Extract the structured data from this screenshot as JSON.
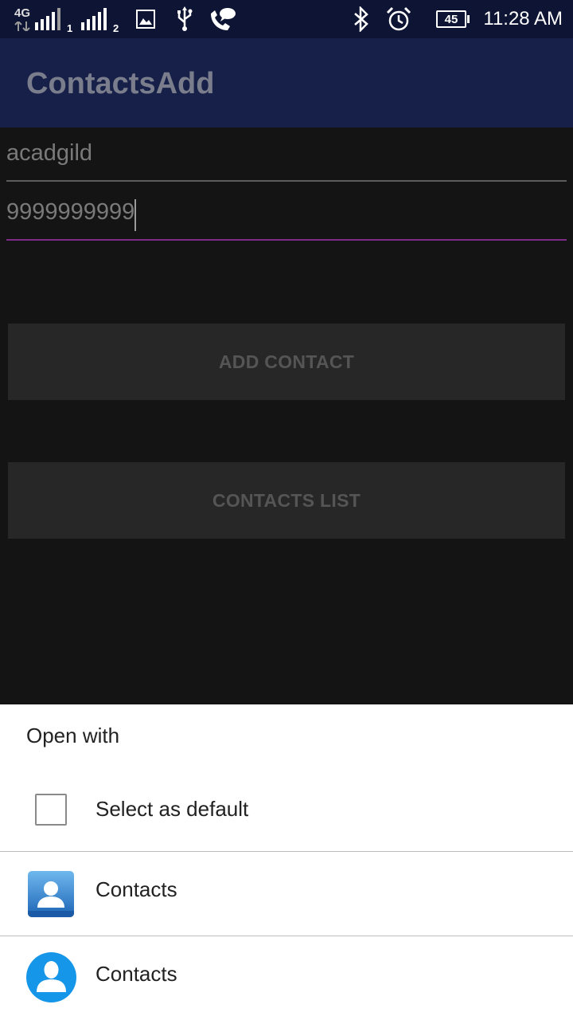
{
  "status_bar": {
    "network_type": "4G",
    "sim1_label": "1",
    "sim2_label": "2",
    "battery_level": "45",
    "time": "11:28 AM"
  },
  "app_bar": {
    "title": "ContactsAdd"
  },
  "form": {
    "name_value": "acadgild",
    "phone_value": "9999999999",
    "add_button_label": "ADD CONTACT",
    "list_button_label": "CONTACTS LIST"
  },
  "chooser": {
    "title": "Open with",
    "default_checkbox_label": "Select as default",
    "default_checked": false,
    "apps": [
      {
        "label": "Contacts",
        "icon": "contacts-square-icon"
      },
      {
        "label": "Contacts",
        "icon": "contacts-round-icon"
      }
    ]
  },
  "colors": {
    "status_bar_bg": "#0e1433",
    "app_bar_bg": "#172049",
    "content_bg": "#141414",
    "focused_underline": "#7e2a86",
    "button_bg": "#272727",
    "sheet_bg": "#ffffff"
  }
}
